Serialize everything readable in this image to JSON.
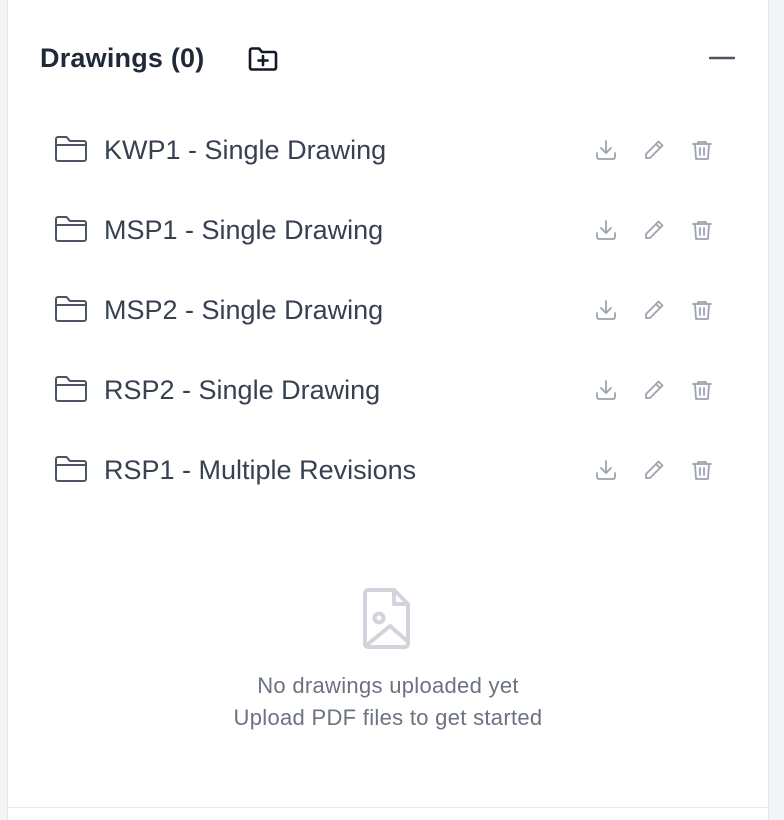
{
  "header": {
    "title": "Drawings (0)",
    "new_folder_icon": "folder-plus-icon",
    "collapse_icon": "minus-icon"
  },
  "drawings": [
    {
      "name": "KWP1 - Single Drawing"
    },
    {
      "name": "MSP1 - Single Drawing"
    },
    {
      "name": "MSP2 - Single Drawing"
    },
    {
      "name": "RSP2 - Single Drawing"
    },
    {
      "name": "RSP1 - Multiple Revisions"
    }
  ],
  "row_actions": [
    "download-icon",
    "pencil-icon",
    "trash-icon"
  ],
  "empty_state": {
    "icon": "image-file-icon",
    "line1": "No drawings uploaded yet",
    "line2": "Upload PDF files to get started"
  },
  "colors": {
    "text_primary": "#1f2937",
    "text_secondary": "#6b7280",
    "icon_muted": "#9ca3af",
    "border": "#e5e7eb"
  }
}
